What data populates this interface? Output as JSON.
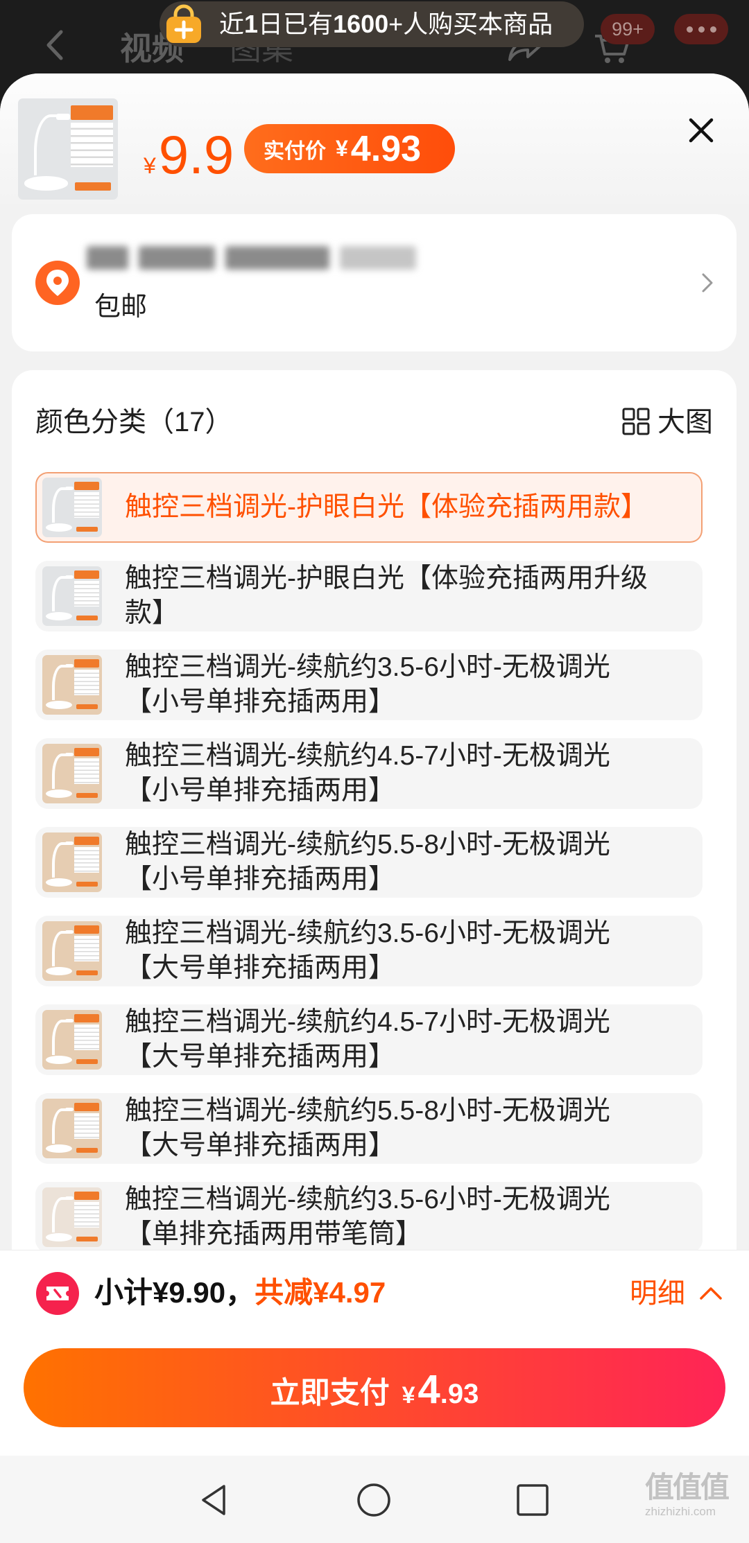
{
  "top_bar": {
    "tabs": [
      "视频",
      "图集"
    ],
    "cart_badge": "99+",
    "banner": {
      "t1": "近",
      "t2": "1",
      "t3": "日已有",
      "t4": "1600",
      "t5": "+人购买本商品"
    }
  },
  "product": {
    "price_symbol": "¥",
    "price": "9.9",
    "actual_label": "实付价",
    "actual_symbol": "¥",
    "actual_price": "4.93"
  },
  "address": {
    "shipping": "包邮"
  },
  "options": {
    "title": "颜色分类（17）",
    "large_view_label": "大图",
    "items": [
      {
        "lines": [
          "触控三档调光-护眼白光【体验充插两用款】"
        ],
        "selected": true,
        "thumb_color": "#e1e3e5"
      },
      {
        "lines": [
          "触控三档调光-护眼白光【体验充插两用升级",
          "款】"
        ],
        "selected": false,
        "thumb_color": "#e1e3e5"
      },
      {
        "lines": [
          "触控三档调光-续航约3.5-6小时-无极调光",
          "【小号单排充插两用】"
        ],
        "selected": false,
        "thumb_color": "#e6cdb2"
      },
      {
        "lines": [
          "触控三档调光-续航约4.5-7小时-无极调光",
          "【小号单排充插两用】"
        ],
        "selected": false,
        "thumb_color": "#e6cdb2"
      },
      {
        "lines": [
          "触控三档调光-续航约5.5-8小时-无极调光",
          "【小号单排充插两用】"
        ],
        "selected": false,
        "thumb_color": "#e6cdb2"
      },
      {
        "lines": [
          "触控三档调光-续航约3.5-6小时-无极调光",
          "【大号单排充插两用】"
        ],
        "selected": false,
        "thumb_color": "#e6cdb2"
      },
      {
        "lines": [
          "触控三档调光-续航约4.5-7小时-无极调光",
          "【大号单排充插两用】"
        ],
        "selected": false,
        "thumb_color": "#e6cdb2"
      },
      {
        "lines": [
          "触控三档调光-续航约5.5-8小时-无极调光",
          "【大号单排充插两用】"
        ],
        "selected": false,
        "thumb_color": "#e6cdb2"
      },
      {
        "lines": [
          "触控三档调光-续航约3.5-6小时-无极调光",
          "【单排充插两用带笔筒】"
        ],
        "selected": false,
        "thumb_color": "#ece2d8"
      }
    ]
  },
  "footer": {
    "subtotal": "小计¥9.90，",
    "discount": "共减¥4.97",
    "detail_label": "明细",
    "pay_label": "立即支付",
    "pay_symbol": "¥",
    "pay_int": "4",
    "pay_dec": ".93"
  },
  "watermark": {
    "logo": "值值值",
    "site": "zhizhizhi.com"
  },
  "icons": {
    "back": "back-arrow-icon",
    "share": "share-icon",
    "cart": "cart-icon",
    "more": "more-dots-icon",
    "banner": "shopping-bag-icon",
    "close": "close-icon",
    "location": "location-pin-icon",
    "address_more": "chevron-right-icon",
    "large_view": "grid-icon",
    "coupon": "coupon-icon",
    "detail": "chevron-up-icon",
    "nav_back": "nav-back-icon",
    "nav_home": "nav-home-icon",
    "nav_recent": "nav-recent-icon"
  },
  "colors": {
    "accent": "#ff5000",
    "selected_bg": "#fff2ec",
    "selected_border": "#f3a074",
    "pay_start": "#ff7200",
    "pay_end": "#ff2456",
    "coupon_red": "#f5224d",
    "location_orange": "#ff6422"
  }
}
